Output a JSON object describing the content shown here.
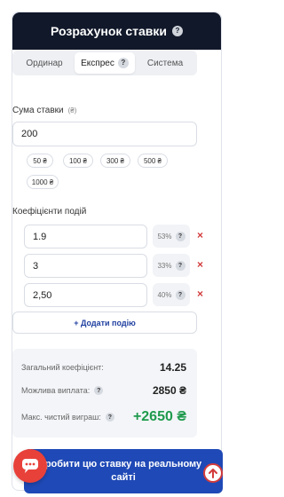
{
  "header": {
    "title": "Розрахунок ставки",
    "help": "?"
  },
  "tabs": [
    {
      "label": "Ординар",
      "help": "?"
    },
    {
      "label": "Експрес",
      "help": "?",
      "active": true
    },
    {
      "label": "Система",
      "help": "?"
    }
  ],
  "stake": {
    "label": "Сума ставки",
    "currency_hint": "(₴)",
    "value": "200",
    "presets": [
      "50 ₴",
      "100 ₴",
      "300 ₴",
      "500 ₴",
      "1000 ₴"
    ]
  },
  "events": {
    "label": "Коефіцієнти подій",
    "rows": [
      {
        "odds": "1.9",
        "pct": "53%",
        "help": "?",
        "remove": "×"
      },
      {
        "odds": "3",
        "pct": "33%",
        "help": "?",
        "remove": "×"
      },
      {
        "odds": "2,50",
        "pct": "40%",
        "help": "?",
        "remove": "×"
      }
    ],
    "add_label": "+ Додати подію"
  },
  "summary": {
    "total_label": "Загальний коефіцієнт:",
    "total_value": "14.25",
    "payout_label": "Можлива виплата:",
    "payout_value": "2850 ₴",
    "profit_label": "Макс. чистий виграш:",
    "profit_value": "+2650 ₴",
    "help": "?"
  },
  "cta": {
    "label": "робити цю ставку на реальному сайті"
  },
  "colors": {
    "header_bg": "#11182a",
    "accent_blue": "#1f49b6",
    "profit_green": "#1f9a4d",
    "remove_red": "#d33b3b",
    "chat_red": "#e8413a"
  },
  "icons": {
    "chat": "chat-bubble-icon",
    "scroll_top": "arrow-up-circle-icon"
  }
}
